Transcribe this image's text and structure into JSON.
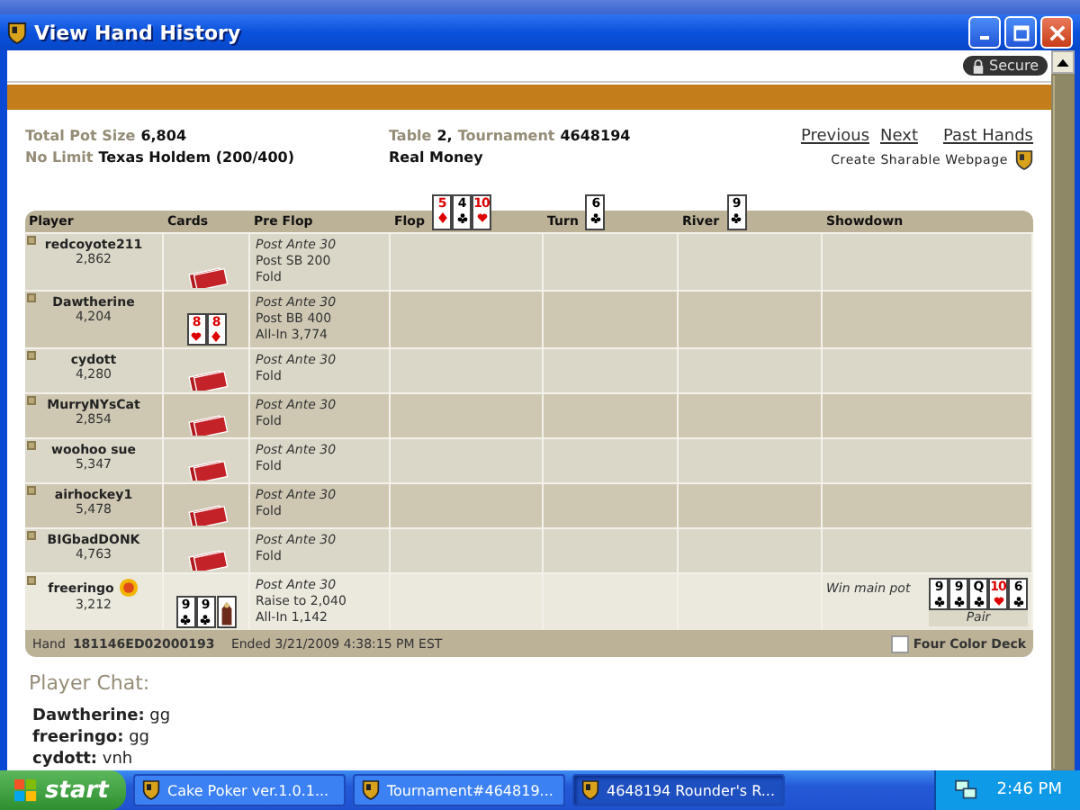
{
  "window": {
    "title": "View Hand History",
    "secure_label": "Secure"
  },
  "summary": {
    "pot_label": "Total Pot Size",
    "pot_value": "6,804",
    "game_label": "No Limit",
    "game_value": "Texas Holdem (200/400)",
    "table_label": "Table",
    "table_value": "2,",
    "tournament_label": "Tournament",
    "tournament_value": "4648194",
    "money": "Real Money"
  },
  "nav_links": [
    "Previous",
    "Next",
    "Past Hands"
  ],
  "share_link": "Create Sharable Webpage",
  "table": {
    "columns": [
      {
        "label": "Player"
      },
      {
        "label": "Cards"
      },
      {
        "label": "Pre Flop"
      },
      {
        "label": "Flop",
        "cards": [
          {
            "rank": "5",
            "kind": "diamonds"
          },
          {
            "rank": "4",
            "kind": "clubs"
          },
          {
            "rank": "10",
            "kind": "hearts"
          }
        ]
      },
      {
        "label": "Turn",
        "cards": [
          {
            "rank": "6",
            "kind": "clubs"
          }
        ]
      },
      {
        "label": "River",
        "cards": [
          {
            "rank": "9",
            "kind": "clubs"
          }
        ]
      },
      {
        "label": "Showdown"
      }
    ],
    "rows": [
      {
        "player": "redcoyote211",
        "chips": "2,862",
        "winner": false,
        "badge": false,
        "kind": "mucked",
        "actions": [
          {
            "kind": "ante",
            "text": "Post Ante 30"
          },
          {
            "kind": "action",
            "text": "Post SB 200"
          },
          {
            "kind": "action",
            "text": "Fold"
          }
        ]
      },
      {
        "player": "Dawtherine",
        "chips": "4,204",
        "winner": false,
        "badge": false,
        "kind": "shown",
        "cards": [
          {
            "rank": "8",
            "kind": "hearts"
          },
          {
            "rank": "8",
            "kind": "diamonds"
          }
        ],
        "actions": [
          {
            "kind": "ante",
            "text": "Post Ante 30"
          },
          {
            "kind": "action",
            "text": "Post BB 400"
          },
          {
            "kind": "action",
            "text": "All-In 3,774"
          }
        ]
      },
      {
        "player": "cydott",
        "chips": "4,280",
        "winner": false,
        "badge": false,
        "kind": "mucked",
        "actions": [
          {
            "kind": "ante",
            "text": "Post Ante 30"
          },
          {
            "kind": "action",
            "text": "Fold"
          }
        ]
      },
      {
        "player": "MurryNYsCat",
        "chips": "2,854",
        "winner": false,
        "badge": false,
        "kind": "mucked",
        "actions": [
          {
            "kind": "ante",
            "text": "Post Ante 30"
          },
          {
            "kind": "action",
            "text": "Fold"
          }
        ]
      },
      {
        "player": "woohoo sue",
        "chips": "5,347",
        "winner": false,
        "badge": false,
        "kind": "mucked",
        "actions": [
          {
            "kind": "ante",
            "text": "Post Ante 30"
          },
          {
            "kind": "action",
            "text": "Fold"
          }
        ]
      },
      {
        "player": "airhockey1",
        "chips": "5,478",
        "winner": false,
        "badge": false,
        "kind": "mucked",
        "actions": [
          {
            "kind": "ante",
            "text": "Post Ante 30"
          },
          {
            "kind": "action",
            "text": "Fold"
          }
        ]
      },
      {
        "player": "BIGbadDONK",
        "chips": "4,763",
        "winner": false,
        "badge": false,
        "kind": "mucked",
        "actions": [
          {
            "kind": "ante",
            "text": "Post Ante 30"
          },
          {
            "kind": "action",
            "text": "Fold"
          }
        ]
      },
      {
        "player": "freeringo",
        "chips": "3,212",
        "winner": true,
        "badge": true,
        "kind": "shown",
        "cards": [
          {
            "rank": "9",
            "kind": "clubs"
          },
          {
            "rank": "9",
            "kind": "clubs"
          },
          {
            "kind": "court"
          }
        ],
        "actions": [
          {
            "kind": "ante",
            "text": "Post Ante 30"
          },
          {
            "kind": "action",
            "text": "Raise to 2,040"
          },
          {
            "kind": "action",
            "text": "All-In 1,142"
          }
        ],
        "showdown": {
          "result": "Win main pot",
          "hand": "Pair",
          "cards": [
            {
              "rank": "9",
              "kind": "clubs"
            },
            {
              "rank": "9",
              "kind": "clubs"
            },
            {
              "rank": "Q",
              "kind": "clubs"
            },
            {
              "rank": "10",
              "kind": "hearts"
            },
            {
              "rank": "6",
              "kind": "clubs"
            }
          ]
        }
      }
    ]
  },
  "footer": {
    "hand_label": "Hand",
    "hand_id": "181146ED02000193",
    "ended": "Ended 3/21/2009 4:38:15 PM EST",
    "four_color_label": "Four Color Deck",
    "four_color_checked": false
  },
  "chat": {
    "title": "Player Chat:",
    "messages": [
      {
        "name": "Dawtherine:",
        "text": "gg"
      },
      {
        "name": "freeringo:",
        "text": "gg"
      },
      {
        "name": "cydott:",
        "text": "vnh"
      }
    ]
  },
  "taskbar": {
    "start": "start",
    "tasks": [
      {
        "label": "Cake Poker ver.1.0.1...",
        "selected": false
      },
      {
        "label": "Tournament#464819...",
        "selected": false
      },
      {
        "label": "4648194 Rounder's R...",
        "selected": true
      }
    ],
    "clock": "2:46 PM"
  }
}
